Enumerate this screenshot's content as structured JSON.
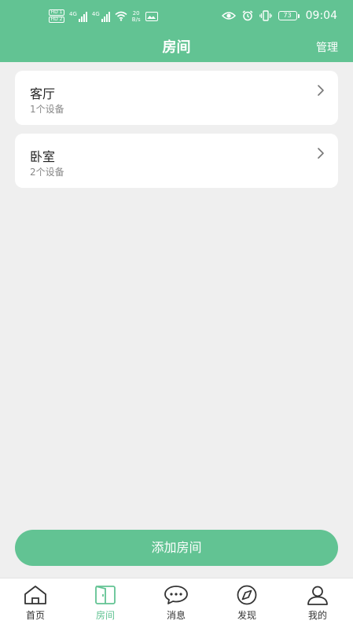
{
  "status_bar": {
    "hd1": "HD 1",
    "hd2": "HD 2",
    "net1": "4G",
    "net2": "4G",
    "speed_value": "20",
    "speed_unit": "B/s",
    "battery": "73",
    "time": "09:04"
  },
  "header": {
    "title": "房间",
    "action_label": "管理"
  },
  "rooms": [
    {
      "name": "客厅",
      "devices": "1个设备"
    },
    {
      "name": "卧室",
      "devices": "2个设备"
    }
  ],
  "add_button_label": "添加房间",
  "tabs": [
    {
      "label": "首页",
      "icon": "home-icon"
    },
    {
      "label": "房间",
      "icon": "door-icon",
      "active": true
    },
    {
      "label": "消息",
      "icon": "message-icon"
    },
    {
      "label": "发现",
      "icon": "compass-icon"
    },
    {
      "label": "我的",
      "icon": "user-icon"
    }
  ],
  "colors": {
    "accent": "#62c393",
    "background": "#efefef"
  }
}
